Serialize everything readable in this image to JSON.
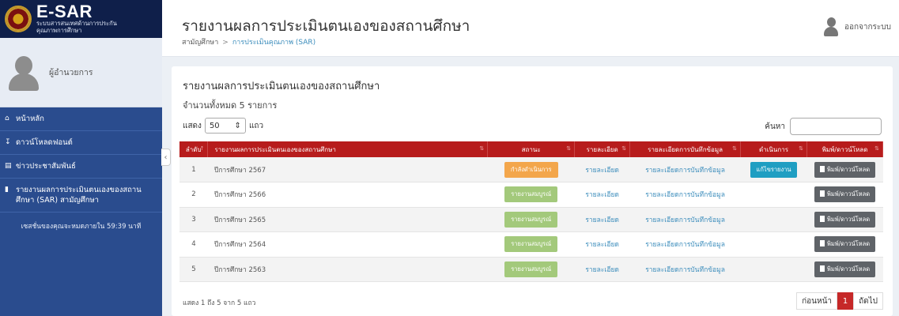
{
  "brand": {
    "title": "E-SAR",
    "subtitle_line1": "ระบบสารสนเทศด้านการประกัน",
    "subtitle_line2": "คุณภาพการศึกษา"
  },
  "user_panel": {
    "name": "ผู้อำนวยการ"
  },
  "sidebar": {
    "items": [
      {
        "icon": "home-icon",
        "label": "หน้าหลัก"
      },
      {
        "icon": "download-icon",
        "label": "ดาวน์โหลดฟอนต์"
      },
      {
        "icon": "newspaper-icon",
        "label": "ข่าวประชาสัมพันธ์"
      },
      {
        "icon": "book-icon",
        "label": "รายงานผลการประเมินตนเองของสถานศึกษา (SAR) สามัญศึกษา"
      }
    ],
    "session_text": "เซสชั่นของคุณจะหมดภายใน 59:39 นาที"
  },
  "header": {
    "title": "รายงานผลการประเมินตนเองของสถานศึกษา",
    "breadcrumb": [
      "สามัญศึกษา",
      "การประเมินคุณภาพ (SAR)"
    ],
    "logout_label": "ออกจากระบบ"
  },
  "box": {
    "title": "รายงานผลการประเมินตนเองของสถานศึกษา",
    "total_text": "จำนวนทั้งหมด 5 รายการ",
    "show_label": "แสดง",
    "show_value": "50",
    "rows_label": "แถว",
    "search_label": "ค้นหา",
    "search_value": ""
  },
  "table": {
    "columns": [
      "ลำดับ",
      "รายงานผลการประเมินตนเองของสถานศึกษา",
      "สถานะ",
      "รายละเอียด",
      "รายละเอียดการบันทึกข้อมูล",
      "ดำเนินการ",
      "พิมพ์/ดาวน์โหลด"
    ],
    "rows": [
      {
        "no": "1",
        "name": "ปีการศึกษา 2567",
        "status": "กำลังดำเนินการ",
        "status_color": "orange",
        "detail": "รายละเอียด",
        "record_detail": "รายละเอียดการบันทึกข้อมูล",
        "action": "แก้ไขรายงาน",
        "print": "พิมพ์/ดาวน์โหลด"
      },
      {
        "no": "2",
        "name": "ปีการศึกษา 2566",
        "status": "รายงานสมบูรณ์",
        "status_color": "green",
        "detail": "รายละเอียด",
        "record_detail": "รายละเอียดการบันทึกข้อมูล",
        "action": "",
        "print": "พิมพ์/ดาวน์โหลด"
      },
      {
        "no": "3",
        "name": "ปีการศึกษา 2565",
        "status": "รายงานสมบูรณ์",
        "status_color": "green",
        "detail": "รายละเอียด",
        "record_detail": "รายละเอียดการบันทึกข้อมูล",
        "action": "",
        "print": "พิมพ์/ดาวน์โหลด"
      },
      {
        "no": "4",
        "name": "ปีการศึกษา 2564",
        "status": "รายงานสมบูรณ์",
        "status_color": "green",
        "detail": "รายละเอียด",
        "record_detail": "รายละเอียดการบันทึกข้อมูล",
        "action": "",
        "print": "พิมพ์/ดาวน์โหลด"
      },
      {
        "no": "5",
        "name": "ปีการศึกษา 2563",
        "status": "รายงานสมบูรณ์",
        "status_color": "green",
        "detail": "รายละเอียด",
        "record_detail": "รายละเอียดการบันทึกข้อมูล",
        "action": "",
        "print": "พิมพ์/ดาวน์โหลด"
      }
    ]
  },
  "footer": {
    "info_text": "แสดง 1 ถึง 5 จาก 5 แถว",
    "prev_label": "ก่อนหน้า",
    "current_page": "1",
    "next_label": "ถัดไป"
  },
  "colors": {
    "sidebar": "#2a4c8e",
    "table_header": "#b71c1c",
    "link": "#3c8dbc",
    "status_orange": "#f3a64b",
    "status_green": "#a3c97b"
  }
}
